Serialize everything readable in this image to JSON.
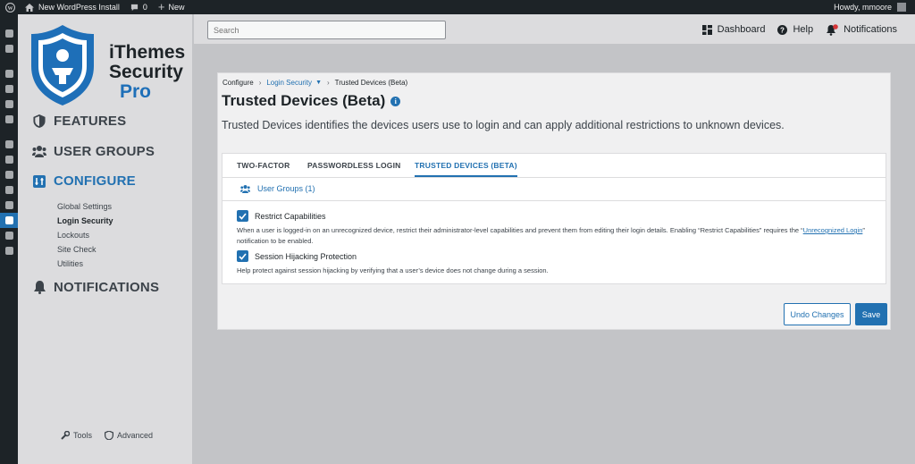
{
  "adminbar": {
    "site_name": "New WordPress Install",
    "comments_count": "0",
    "new_label": "New",
    "greeting": "Howdy, mmoore"
  },
  "sidebar": {
    "brand_line1": "iThemes",
    "brand_line2": "Security",
    "brand_line3": "Pro",
    "nav": {
      "features": "FEATURES",
      "user_groups": "USER GROUPS",
      "configure": "CONFIGURE",
      "notifications": "NOTIFICATIONS"
    },
    "configure_items": [
      "Global Settings",
      "Login Security",
      "Lockouts",
      "Site Check",
      "Utilities"
    ],
    "footer": {
      "tools": "Tools",
      "advanced": "Advanced"
    }
  },
  "topbar": {
    "search_placeholder": "Search",
    "dashboard": "Dashboard",
    "help": "Help",
    "notifications": "Notifications"
  },
  "breadcrumb": {
    "configure": "Configure",
    "login_security": "Login Security",
    "current": "Trusted Devices (Beta)"
  },
  "page": {
    "title": "Trusted Devices (Beta)",
    "description": "Trusted Devices identifies the devices users use to login and can apply additional restrictions to unknown devices."
  },
  "tabs": {
    "two_factor": "TWO-FACTOR",
    "passwordless": "PASSWORDLESS LOGIN",
    "trusted": "TRUSTED DEVICES (BETA)"
  },
  "user_groups_link": "User Groups (1)",
  "options": {
    "restrict": {
      "label": "Restrict Capabilities",
      "help_before": "When a user is logged-in on an unrecognized device, restrict their administrator-level capabilities and prevent them from editing their login details. Enabling “Restrict Capabilities” requires the “",
      "help_link": "Unrecognized Login",
      "help_after": "” notification to be enabled."
    },
    "hijack": {
      "label": "Session Hijacking Protection",
      "help": "Help protect against session hijacking by verifying that a user’s device does not change during a session."
    }
  },
  "buttons": {
    "undo": "Undo Changes",
    "save": "Save"
  },
  "colors": {
    "accent": "#2271b1",
    "adminbar": "#1d2327"
  }
}
